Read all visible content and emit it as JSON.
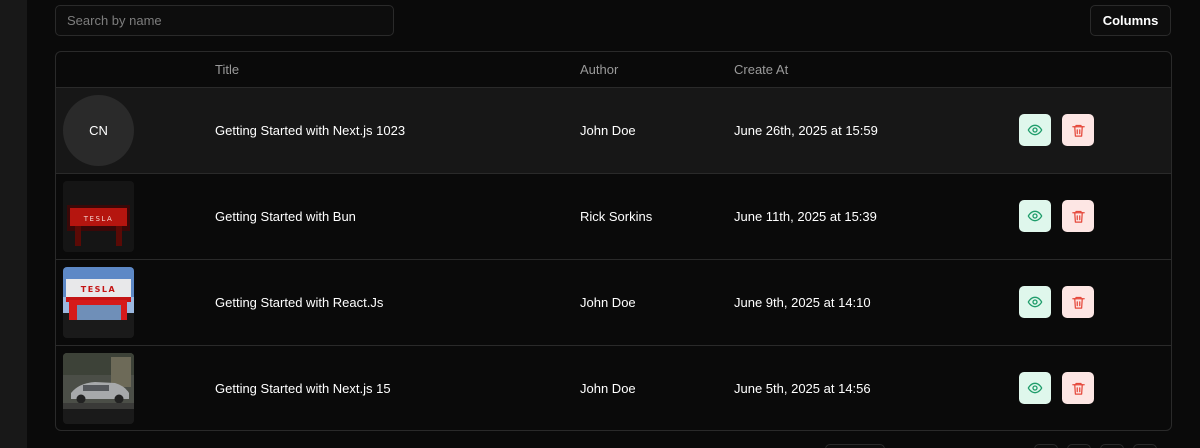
{
  "search": {
    "placeholder": "Search by name"
  },
  "toolbar": {
    "columns_label": "Columns"
  },
  "table": {
    "headers": {
      "title": "Title",
      "author": "Author",
      "created": "Create At"
    },
    "rows": [
      {
        "thumb": "avatar",
        "avatar_text": "CN",
        "title": "Getting Started with Next.js 1023",
        "author": "John Doe",
        "created": "June 26th, 2025 at 15:59"
      },
      {
        "thumb": "image-dark-tesla-sign",
        "title": "Getting Started with Bun",
        "author": "Rick Sorkins",
        "created": "June 11th, 2025 at 15:39"
      },
      {
        "thumb": "image-tesla-sign-sky",
        "title": "Getting Started with React.Js",
        "author": "John Doe",
        "created": "June 9th, 2025 at 14:10"
      },
      {
        "thumb": "image-car-street",
        "title": "Getting Started with Next.js 15",
        "author": "John Doe",
        "created": "June 5th, 2025 at 14:56"
      }
    ]
  },
  "icons": {
    "view": "eye-icon",
    "delete": "trash-icon"
  },
  "colors": {
    "view_bg": "#dff7ec",
    "view_fg": "#1f9d6b",
    "delete_bg": "#fde6e4",
    "delete_fg": "#e5483b",
    "background": "#0a0a0a"
  }
}
